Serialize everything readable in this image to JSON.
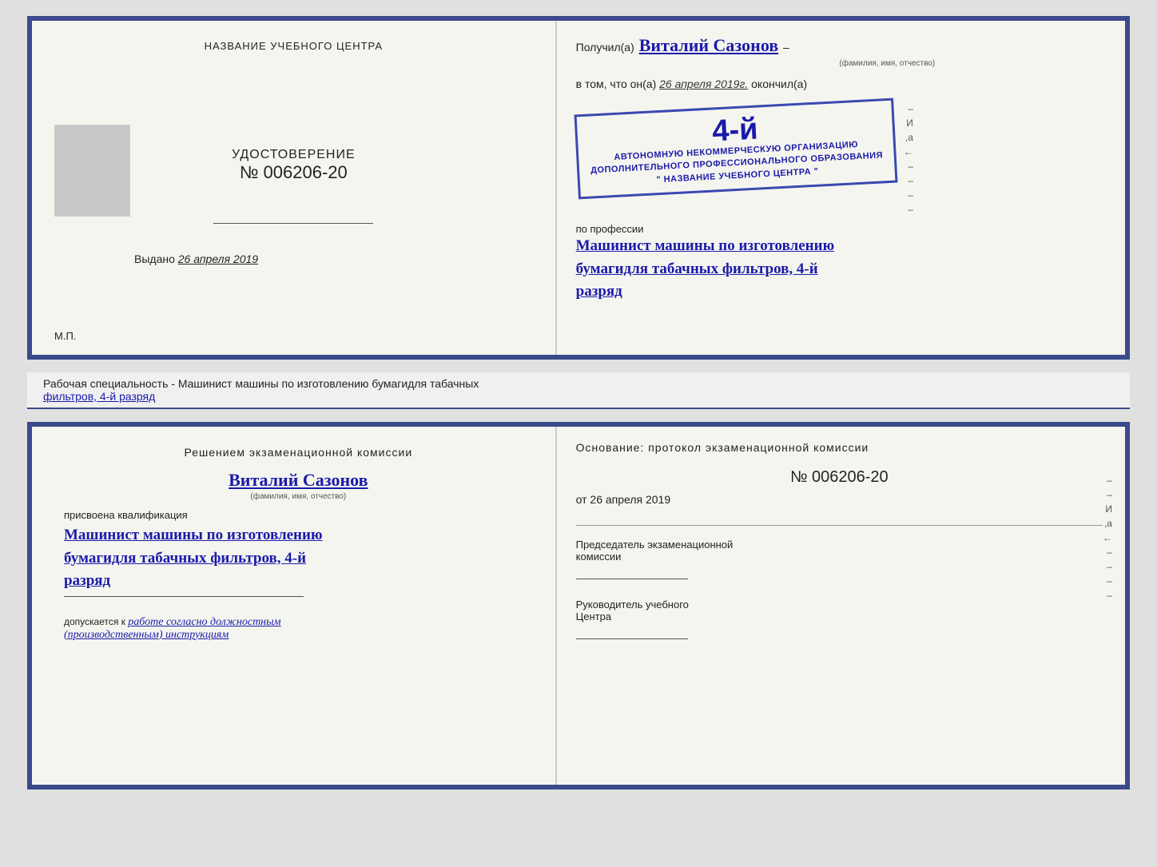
{
  "topDoc": {
    "left": {
      "trainingCenterLabel": "НАЗВАНИЕ УЧЕБНОГО ЦЕНТРА",
      "certTitle": "УДОСТОВЕРЕНИЕ",
      "certNumber": "№ 006206-20",
      "issuedLabel": "Выдано",
      "issuedDate": "26 апреля 2019",
      "mpLabel": "М.П."
    },
    "right": {
      "recipientPrefix": "Получил(а)",
      "recipientName": "Виталий Сазонов",
      "recipientFieldLabel": "(фамилия, имя, отчество)",
      "datePrefix": "в том, что он(а)",
      "dateValue": "26 апреля 2019г.",
      "dateSuffix": "окончил(а)",
      "stampNumber": "4-й",
      "stampLine1": "АВТОНОМНУЮ НЕКОММЕРЧЕСКУЮ ОРГАНИЗАЦИЮ",
      "stampLine2": "ДОПОЛНИТЕЛЬНОГО ПРОФЕССИОНАЛЬНОГО ОБРАЗОВАНИЯ",
      "stampLine3": "\" НАЗВАНИЕ УЧЕБНОГО ЦЕНТРА \"",
      "professionLabel": "по профессии",
      "professionLine1": "Машинист машины по изготовлению",
      "professionLine2": "бумагидля табачных фильтров, 4-й",
      "professionLine3": "разряд",
      "andLabel": "И",
      "aLabel": ",а",
      "leftArrowLabel": "←"
    }
  },
  "caption": {
    "text": "Рабочая специальность - Машинист машины по изготовлению бумагидля табачных",
    "underlineText": "фильтров, 4-й разряд"
  },
  "bottomDoc": {
    "left": {
      "title": "Решением  экзаменационной  комиссии",
      "name": "Виталий Сазонов",
      "nameFieldLabel": "(фамилия, имя, отчество)",
      "qualificationLabel": "присвоена квалификация",
      "qualLine1": "Машинист машины по изготовлению",
      "qualLine2": "бумагидля табачных фильтров, 4-й",
      "qualLine3": "разряд",
      "allowedPrefix": "допускается к",
      "allowedText": "работе согласно должностным",
      "allowedText2": "(производственным) инструкциям"
    },
    "right": {
      "basisTitle": "Основание:  протокол  экзаменационной  комиссии",
      "protocolNumber": "№  006206-20",
      "protocolDatePrefix": "от",
      "protocolDate": "26 апреля 2019",
      "chairmanTitle": "Председатель экзаменационной",
      "chairmanTitle2": "комиссии",
      "directorTitle": "Руководитель учебного",
      "directorTitle2": "Центра",
      "andLabel": "И",
      "aLabel": ",а",
      "leftArrowLabel": "←"
    }
  }
}
